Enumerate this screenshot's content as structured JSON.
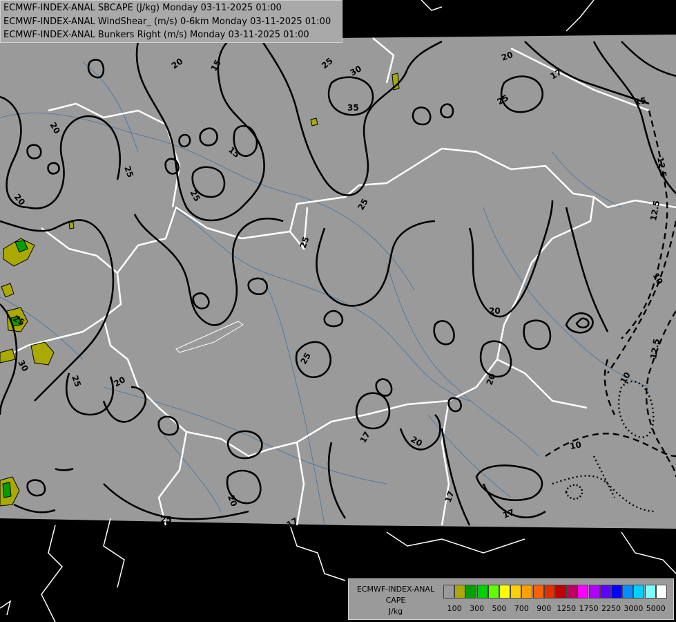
{
  "header": {
    "lines": [
      "ECMWF-INDEX-ANAL SBCAPE (J/kg) Monday 03-11-2025 01:00",
      "ECMWF-INDEX-ANAL WindShear_ (m/s) 0-6km Monday 03-11-2025 01:00",
      "ECMWF-INDEX-ANAL Bunkers Right (m/s) Monday 03-11-2025 01:00"
    ]
  },
  "contour_labels": [
    "20",
    "15",
    "25",
    "30",
    "35",
    "17",
    "20",
    "15",
    "25",
    "12.5",
    "20",
    "25",
    "15",
    "12.5",
    "25",
    "20",
    "25",
    "25",
    "10",
    "20",
    "30",
    "25",
    "20",
    "25",
    "20",
    "12.5",
    "10",
    "25",
    "17",
    "20",
    "10",
    "20",
    "17",
    "25",
    "17",
    "17"
  ],
  "legend": {
    "title_lines": [
      "ECMWF-INDEX-ANAL",
      "CAPE",
      "J/kg"
    ],
    "colors": [
      "#9a9a9a",
      "#a9a900",
      "#00a000",
      "#00d000",
      "#60ff00",
      "#ffff00",
      "#ffd000",
      "#ffa000",
      "#ff6000",
      "#e03000",
      "#c00000",
      "#c00060",
      "#ff00ff",
      "#b000ff",
      "#6000ff",
      "#0000ff",
      "#0090ff",
      "#00d0ff",
      "#80ffff",
      "#ffffff"
    ],
    "ticks": [
      "100",
      "300",
      "500",
      "700",
      "900",
      "1250",
      "1750",
      "2250",
      "3000",
      "5000"
    ]
  }
}
